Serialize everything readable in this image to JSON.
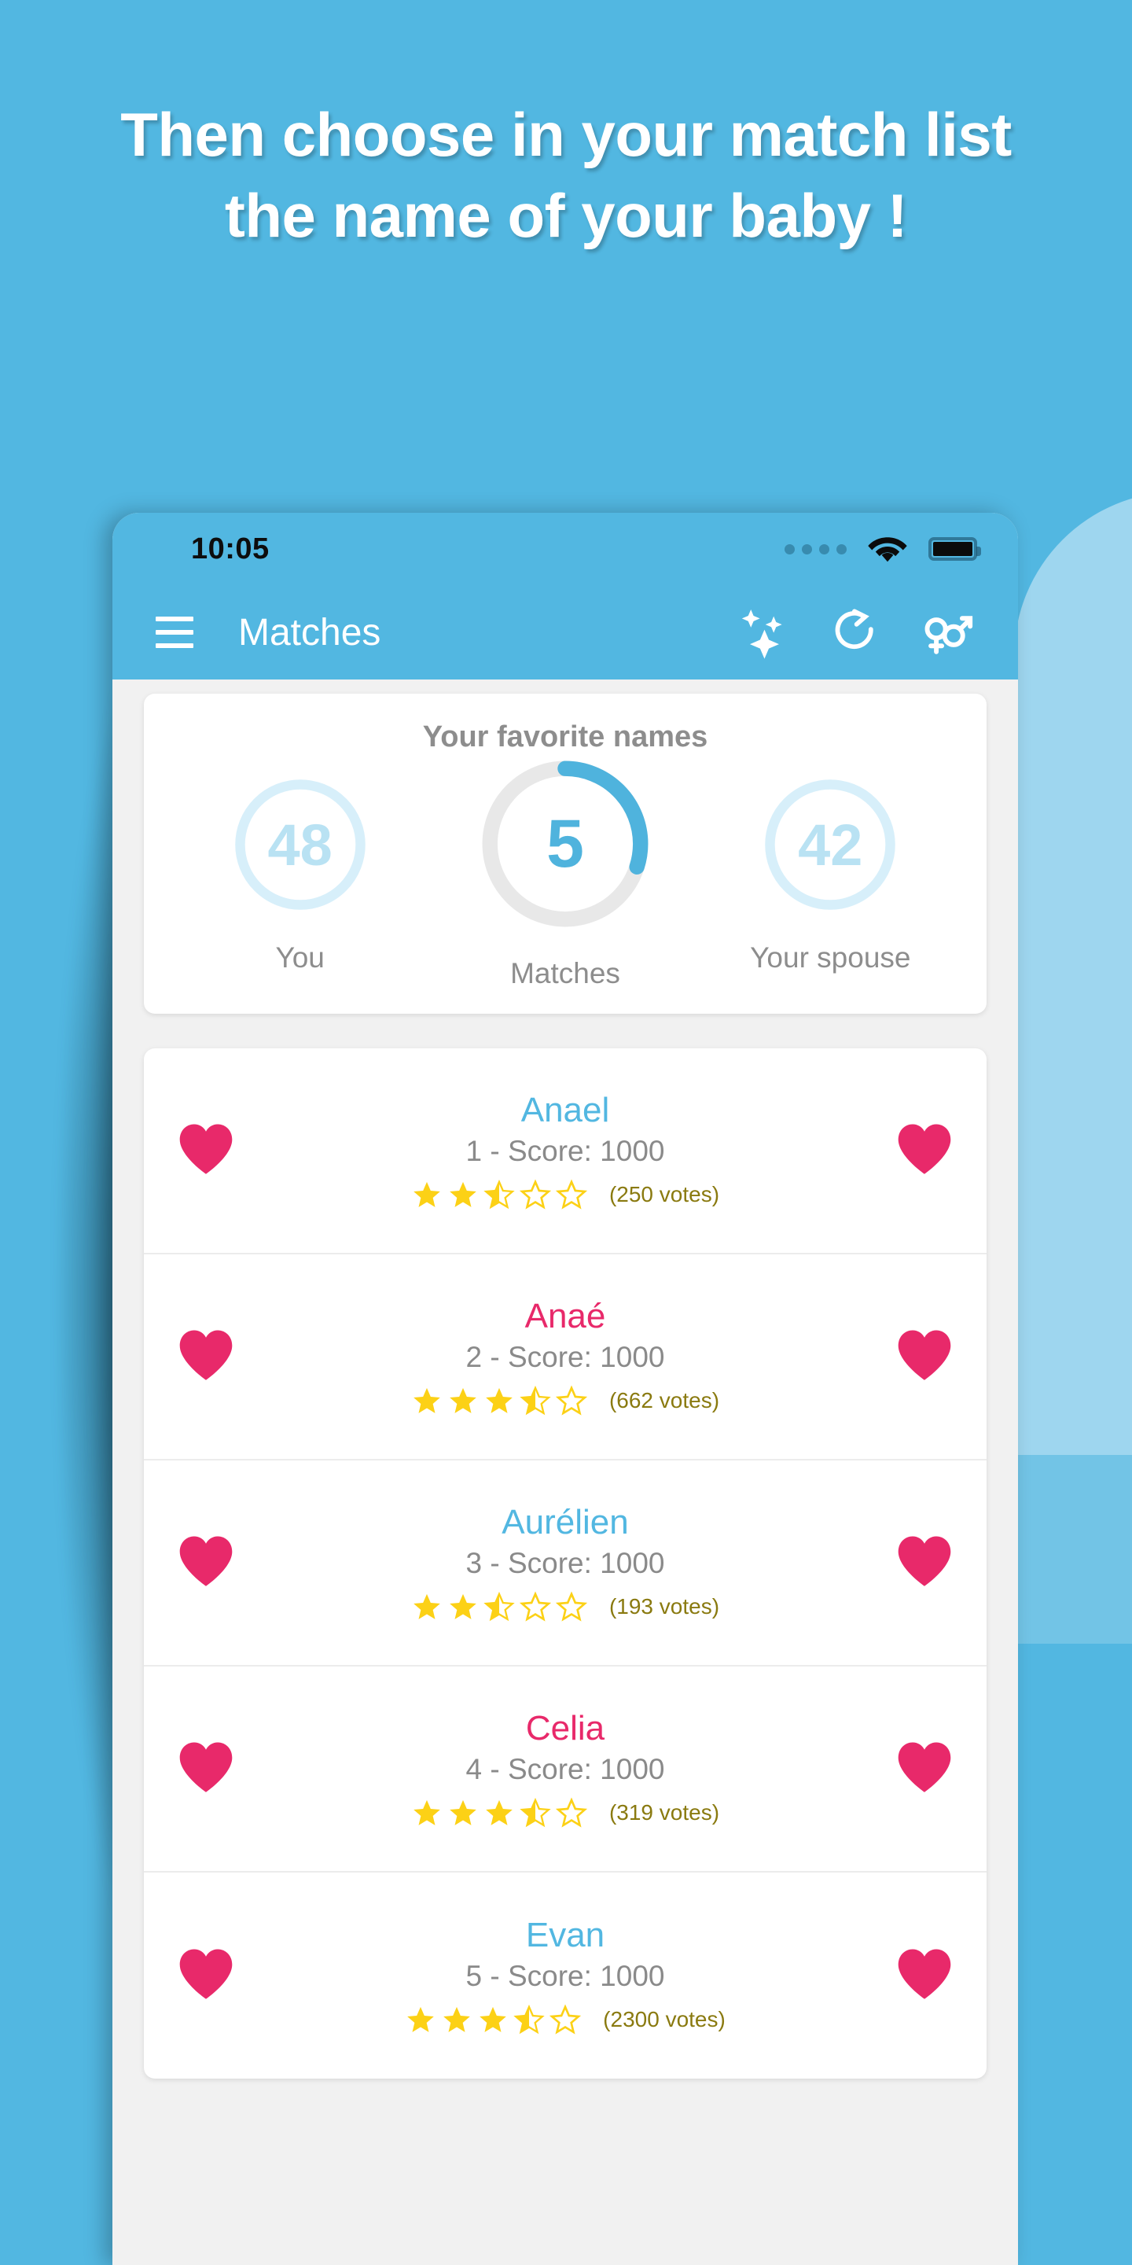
{
  "promo": {
    "headline": "Then choose in your match list the name of your baby !"
  },
  "statusbar": {
    "time": "10:05",
    "signal_icon": "signal-dots-icon",
    "wifi_icon": "wifi-icon",
    "battery_icon": "battery-full-icon"
  },
  "appbar": {
    "menu_icon": "hamburger-menu-icon",
    "title": "Matches",
    "actions": [
      {
        "name": "sparkles-icon",
        "label": "Suggestions"
      },
      {
        "name": "refresh-icon",
        "label": "Refresh"
      },
      {
        "name": "gender-icon",
        "label": "Gender filter"
      }
    ]
  },
  "stats": {
    "title": "Your favorite names",
    "you": {
      "value": "48",
      "label": "You"
    },
    "matches": {
      "value": "5",
      "label": "Matches",
      "progress_percent": 30
    },
    "spouse": {
      "value": "42",
      "label": "Your spouse"
    },
    "colors": {
      "accent": "#4fb3dd",
      "muted_ring": "#d7effa",
      "track": "#e8e8e8"
    }
  },
  "list": {
    "rows": [
      {
        "name": "Anael",
        "gender": "boy",
        "score_text": "1 - Score: 1000",
        "rating": 2.5,
        "votes_text": "(250 votes)",
        "liked_by_you": true,
        "liked_by_spouse": true
      },
      {
        "name": "Anaé",
        "gender": "girl",
        "score_text": "2 - Score: 1000",
        "rating": 3.5,
        "votes_text": "(662 votes)",
        "liked_by_you": true,
        "liked_by_spouse": true
      },
      {
        "name": "Aurélien",
        "gender": "boy",
        "score_text": "3 - Score: 1000",
        "rating": 2.5,
        "votes_text": "(193 votes)",
        "liked_by_you": true,
        "liked_by_spouse": true
      },
      {
        "name": "Celia",
        "gender": "girl",
        "score_text": "4 - Score: 1000",
        "rating": 3.5,
        "votes_text": "(319 votes)",
        "liked_by_you": true,
        "liked_by_spouse": true
      },
      {
        "name": "Evan",
        "gender": "boy",
        "score_text": "5 - Score: 1000",
        "rating": 3.5,
        "votes_text": "(2300 votes)",
        "liked_by_you": true,
        "liked_by_spouse": true
      }
    ],
    "heart_icon": "heart-filled-icon",
    "star_icon": "star-icon",
    "heart_color": "#e8296a",
    "star_color": "#fcd116"
  }
}
